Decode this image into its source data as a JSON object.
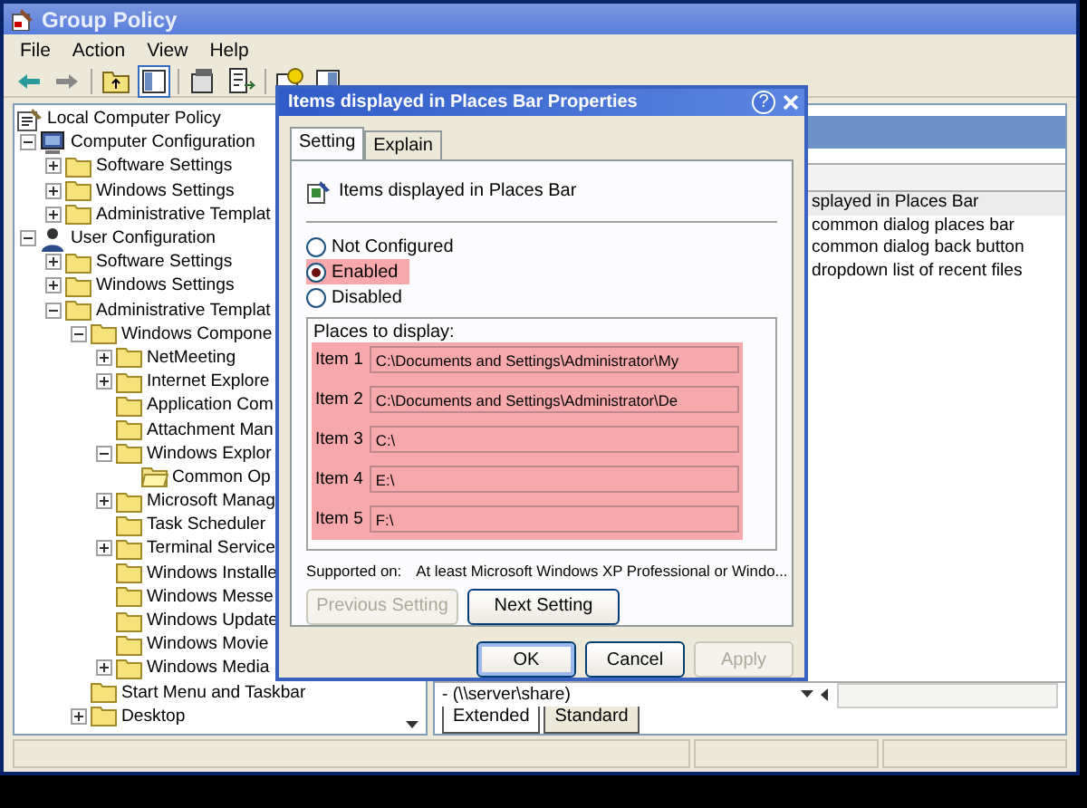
{
  "window": {
    "title": "Group Policy"
  },
  "menu": [
    "File",
    "Action",
    "View",
    "Help"
  ],
  "tree": [
    {
      "label": "Local Computer Policy",
      "kind": "policy",
      "children": [
        {
          "label": "Computer Configuration",
          "kind": "computer",
          "expanded": true,
          "children": [
            {
              "label": "Software Settings",
              "kind": "folder",
              "expanded": false
            },
            {
              "label": "Windows Settings",
              "kind": "folder",
              "expanded": false
            },
            {
              "label": "Administrative Templat",
              "kind": "folder",
              "expanded": false
            }
          ]
        },
        {
          "label": "User Configuration",
          "kind": "user",
          "expanded": true,
          "children": [
            {
              "label": "Software Settings",
              "kind": "folder",
              "expanded": false
            },
            {
              "label": "Windows Settings",
              "kind": "folder",
              "expanded": false
            },
            {
              "label": "Administrative Templat",
              "kind": "folder",
              "expanded": true,
              "children": [
                {
                  "label": "Windows Compone",
                  "kind": "folder",
                  "expanded": true,
                  "children": [
                    {
                      "label": "NetMeeting",
                      "kind": "folder",
                      "expanded": false
                    },
                    {
                      "label": "Internet Explore",
                      "kind": "folder",
                      "expanded": false
                    },
                    {
                      "label": "Application Com",
                      "kind": "folder"
                    },
                    {
                      "label": "Attachment Man",
                      "kind": "folder"
                    },
                    {
                      "label": "Windows Explor",
                      "kind": "folder",
                      "expanded": true,
                      "children": [
                        {
                          "label": "Common Op",
                          "kind": "open-folder"
                        }
                      ]
                    },
                    {
                      "label": "Microsoft Manag",
                      "kind": "folder",
                      "expanded": false
                    },
                    {
                      "label": "Task Scheduler",
                      "kind": "folder"
                    },
                    {
                      "label": "Terminal Service",
                      "kind": "folder",
                      "expanded": false
                    },
                    {
                      "label": "Windows Installe",
                      "kind": "folder"
                    },
                    {
                      "label": "Windows Messe",
                      "kind": "folder"
                    },
                    {
                      "label": "Windows Update",
                      "kind": "folder"
                    },
                    {
                      "label": "Windows Movie",
                      "kind": "folder"
                    },
                    {
                      "label": "Windows Media",
                      "kind": "folder",
                      "expanded": false
                    }
                  ]
                },
                {
                  "label": "Start Menu and Taskbar",
                  "kind": "folder"
                },
                {
                  "label": "Desktop",
                  "kind": "folder",
                  "expanded": false
                }
              ]
            }
          ]
        }
      ]
    }
  ],
  "details": {
    "rows": [
      {
        "text": "splayed in Places Bar",
        "selected": true
      },
      {
        "text": "common dialog places bar",
        "selected": false
      },
      {
        "text": "common dialog back button",
        "selected": false
      },
      {
        "text": "dropdown list of recent files",
        "selected": false
      }
    ],
    "path_row": "- (\\\\server\\share)",
    "view_tabs": [
      {
        "label": "Extended",
        "selected": true
      },
      {
        "label": "Standard",
        "selected": false
      }
    ]
  },
  "dialog": {
    "title": "Items displayed in Places Bar Properties",
    "help": "?",
    "tabs": [
      {
        "label": "Setting",
        "selected": true
      },
      {
        "label": "Explain",
        "selected": false
      }
    ],
    "heading": "Items displayed in Places Bar",
    "options": [
      {
        "label": "Not Configured",
        "selected": false,
        "highlighted": false
      },
      {
        "label": "Enabled",
        "selected": true,
        "highlighted": true
      },
      {
        "label": "Disabled",
        "selected": false,
        "highlighted": false
      }
    ],
    "group": {
      "title": "Places to display:",
      "highlighted": true,
      "items": [
        {
          "label": "Item 1",
          "value": "C:\\Documents and Settings\\Administrator\\My"
        },
        {
          "label": "Item 2",
          "value": "C:\\Documents and Settings\\Administrator\\De"
        },
        {
          "label": "Item 3",
          "value": "C:\\"
        },
        {
          "label": "Item 4",
          "value": "E:\\"
        },
        {
          "label": "Item 5",
          "value": "F:\\"
        }
      ]
    },
    "supported": {
      "label": "Supported on:",
      "value": "At least Microsoft Windows XP Professional or Windo..."
    },
    "nav_buttons": [
      {
        "label": "Previous Setting",
        "disabled": true
      },
      {
        "label": "Next Setting",
        "disabled": false
      }
    ],
    "buttons": [
      {
        "label": "OK",
        "disabled": false,
        "default": true
      },
      {
        "label": "Cancel",
        "disabled": false,
        "default": false
      },
      {
        "label": "Apply",
        "disabled": true,
        "default": false
      }
    ]
  }
}
